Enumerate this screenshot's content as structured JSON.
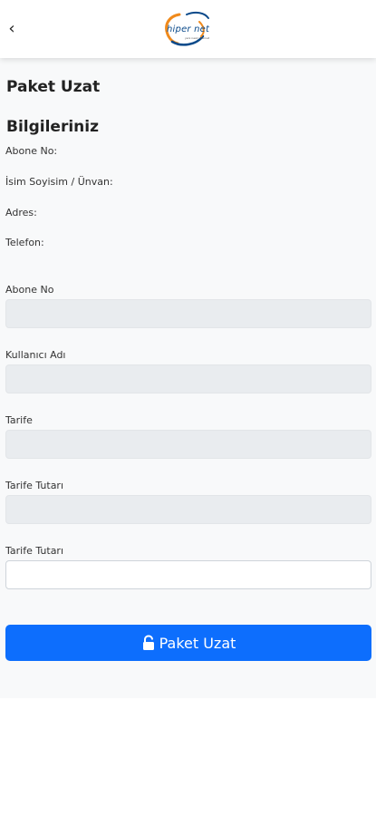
{
  "header": {
    "back_icon": "chevron-left-icon",
    "back_glyph": "‹",
    "logo_text": "hiper net",
    "logo_tagline": "yeni nesil internet"
  },
  "page": {
    "title": "Paket Uzat"
  },
  "info": {
    "section_title": "Bilgileriniz",
    "labels": [
      "Abone No:",
      "İsim Soyisim / Ünvan:",
      "Adres:",
      "Telefon:"
    ]
  },
  "form": {
    "fields": [
      {
        "label": "Abone No",
        "value": "",
        "readonly": true
      },
      {
        "label": "Kullanıcı Adı",
        "value": "",
        "readonly": true
      },
      {
        "label": "Tarife",
        "value": "",
        "readonly": true
      },
      {
        "label": "Tarife Tutarı",
        "value": "",
        "readonly": true
      },
      {
        "label": "Tarife Tutarı",
        "value": "",
        "readonly": false
      }
    ],
    "submit_label": "Paket Uzat",
    "submit_icon": "lock-icon"
  },
  "colors": {
    "primary": "#0d6efd",
    "readonly_field": "#e9ecef",
    "content_bg": "#f8f9fa",
    "logo_blue": "#0b4a8a",
    "logo_orange": "#f08a1c"
  }
}
